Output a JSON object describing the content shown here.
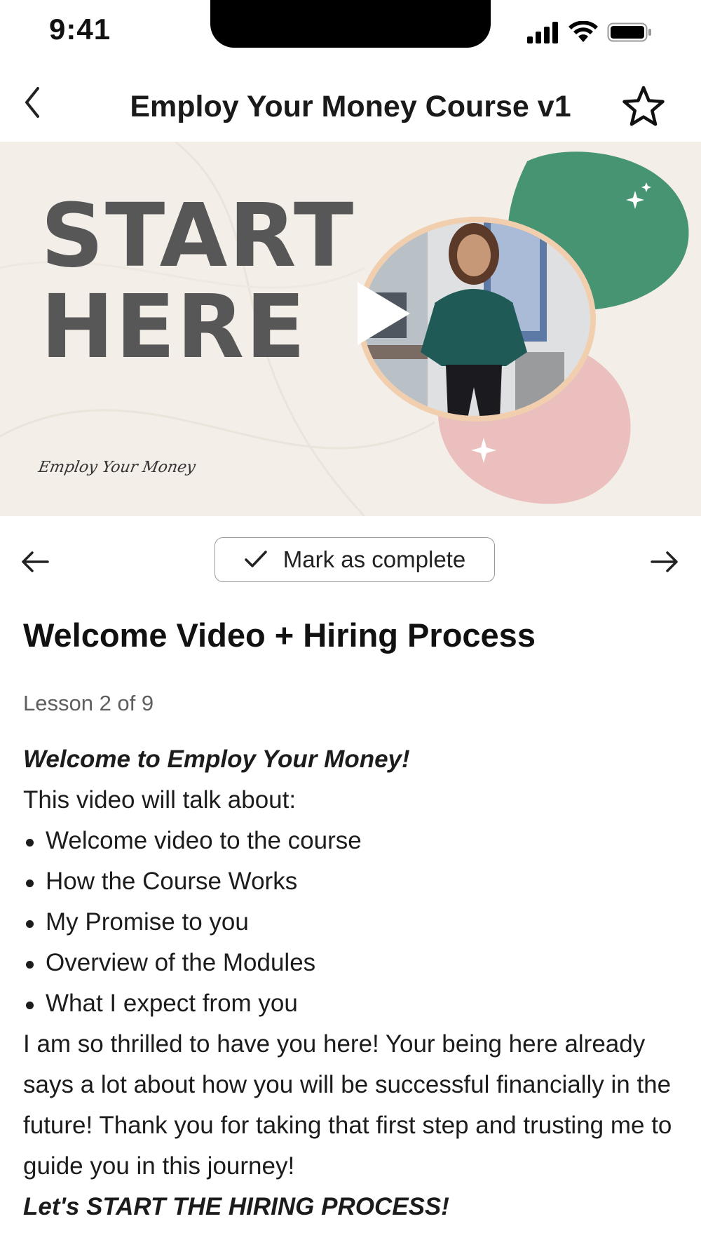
{
  "status": {
    "time": "9:41"
  },
  "nav": {
    "title": "Employ Your Money Course v1"
  },
  "video": {
    "headline_line1": "START",
    "headline_line2": "HERE",
    "signature": "Employ Your Money"
  },
  "controls": {
    "complete_label": "Mark as complete"
  },
  "lesson": {
    "title": "Welcome Video + Hiring Process",
    "progress": "Lesson 2 of 9",
    "intro": "Welcome to Employ Your Money!",
    "subhead": "This video will talk about:",
    "bullets": [
      "Welcome video to the course",
      "How the Course Works",
      "My Promise to you",
      "Overview of the Modules",
      "What I expect from you"
    ],
    "paragraph": "I am so thrilled to have you here! Your being here already says a lot about how you will be successful financially in the future! Thank you for taking that first step and trusting me to guide you in this journey!",
    "closing": "Let's START THE HIRING PROCESS!"
  },
  "colors": {
    "green_blob": "#479472",
    "pink_blob": "#ebbfbe",
    "video_bg": "#f3eee8",
    "headline": "#575757"
  }
}
